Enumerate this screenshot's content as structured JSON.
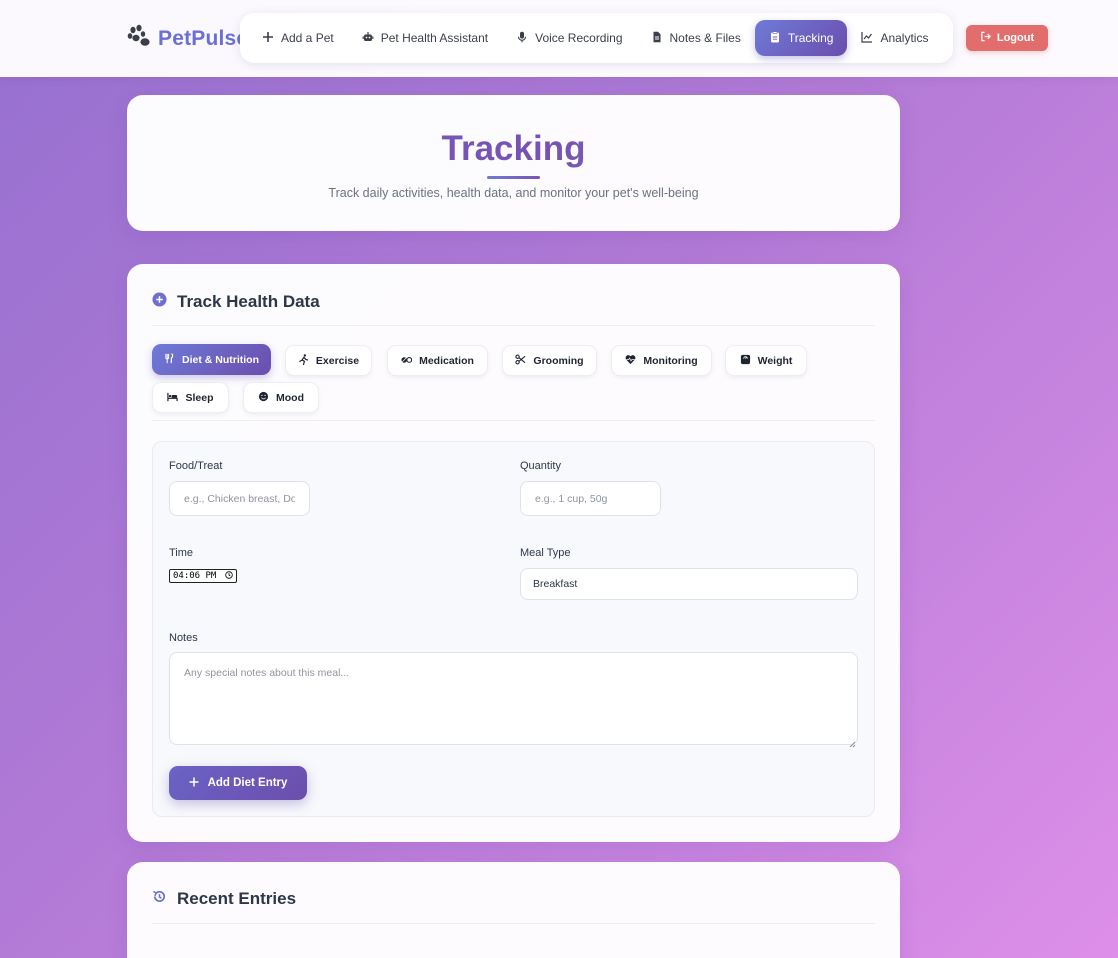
{
  "brand": {
    "name": "PetPulse",
    "icon": "paw-icon"
  },
  "nav": {
    "items": [
      {
        "label": "Add a Pet",
        "icon": "plus-icon"
      },
      {
        "label": "Pet Health Assistant",
        "icon": "robot-icon"
      },
      {
        "label": "Voice Recording",
        "icon": "microphone-icon"
      },
      {
        "label": "Notes & Files",
        "icon": "file-icon"
      },
      {
        "label": "Tracking",
        "icon": "clipboard-icon",
        "active": true
      },
      {
        "label": "Analytics",
        "icon": "line-chart-icon"
      }
    ],
    "logout": "Logout"
  },
  "hero": {
    "title": "Tracking",
    "subtitle": "Track daily activities, health data, and monitor your pet's well-being"
  },
  "track": {
    "title": "Track Health Data",
    "tabs": [
      {
        "label": "Diet & Nutrition",
        "icon": "utensils-icon",
        "active": true
      },
      {
        "label": "Exercise",
        "icon": "running-icon"
      },
      {
        "label": "Medication",
        "icon": "pills-icon"
      },
      {
        "label": "Grooming",
        "icon": "scissors-icon"
      },
      {
        "label": "Monitoring",
        "icon": "heartbeat-icon"
      },
      {
        "label": "Weight",
        "icon": "scale-icon"
      },
      {
        "label": "Sleep",
        "icon": "bed-icon"
      },
      {
        "label": "Mood",
        "icon": "smile-icon"
      }
    ],
    "form": {
      "food_label": "Food/Treat",
      "food_placeholder": "e.g., Chicken breast, Dog food",
      "quantity_label": "Quantity",
      "quantity_placeholder": "e.g., 1 cup, 50g",
      "time_label": "Time",
      "time_value": "04:06 PM",
      "meal_type_label": "Meal Type",
      "meal_type_value": "Breakfast",
      "notes_label": "Notes",
      "notes_placeholder": "Any special notes about this meal...",
      "submit_label": "Add Diet Entry"
    }
  },
  "recent": {
    "title": "Recent Entries",
    "icon": "history-icon"
  },
  "colors": {
    "accent": "#6e7ad8",
    "accent_dark": "#6c4eac",
    "logout": "#e26d6d",
    "brand": "#6a70d6"
  }
}
